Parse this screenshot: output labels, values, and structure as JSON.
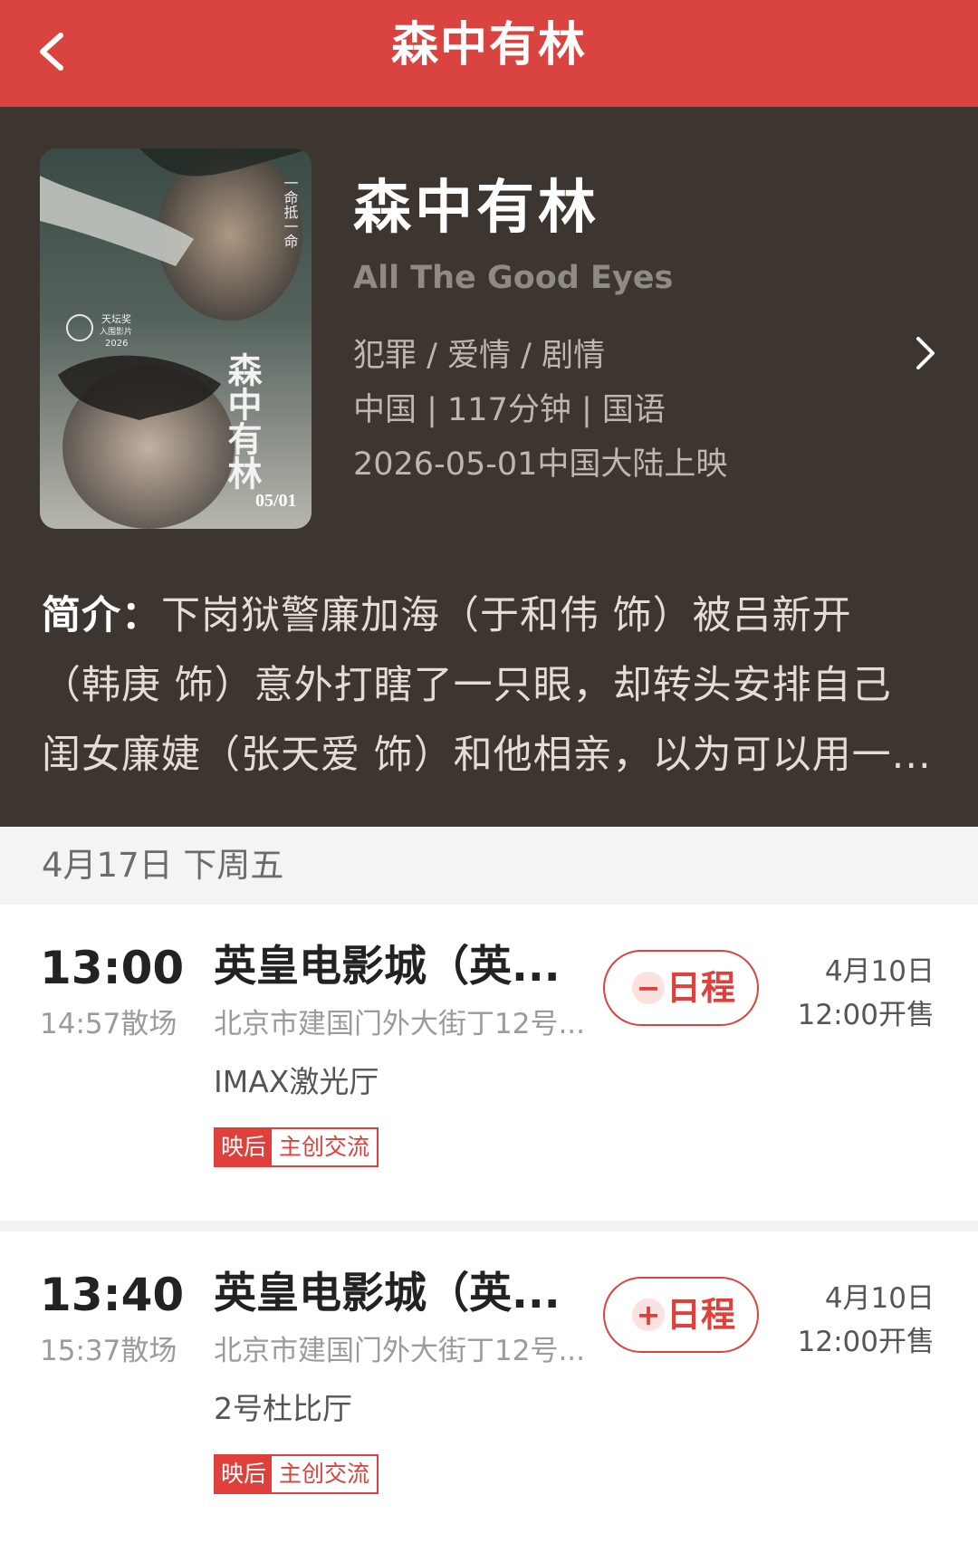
{
  "header": {
    "title": "森中有林",
    "back_icon": "chevron-left-icon"
  },
  "colors": {
    "header_bg": "#d94440",
    "info_bg": "#3d3630",
    "accent": "#e0403c"
  },
  "movie": {
    "title": "森中有林",
    "title_en": "All The Good Eyes",
    "genres": "犯罪 / 爱情 / 剧情",
    "country_duration_language": "中国 | 117分钟 | 国语",
    "release": "2026-05-01中国大陆上映",
    "synopsis_label": "简介：",
    "synopsis_lines": [
      "下岗狱警廉加海（于和伟 饰）被吕新开",
      "（韩庚 饰）意外打瞎了一只眼，却转头安排自己",
      "闺女廉婕（张天爱 饰）和他相亲，以为可以用一..."
    ],
    "detail_icon": "chevron-right-icon"
  },
  "poster": {
    "tagline": "一命抵一命",
    "title_calligraphy": "森中有林",
    "award_title": "天坛奖",
    "award_sub": "入围影片",
    "award_year": "2026",
    "date": "05/01"
  },
  "date_bar": {
    "label": "4月17日 下周五"
  },
  "showtimes": [
    {
      "start": "13:00",
      "end": "14:57散场",
      "cinema": "英皇电影城（英...",
      "address": "北京市建国门外大街丁12号...",
      "hall": "IMAX激光厅",
      "tag_a": "映后",
      "tag_b": "主创交流",
      "schedule_icon": "minus-icon",
      "schedule_symbol": "−",
      "schedule_label": "日程",
      "sale_date": "4月10日",
      "sale_time": "12:00开售"
    },
    {
      "start": "13:40",
      "end": "15:37散场",
      "cinema": "英皇电影城（英...",
      "address": "北京市建国门外大街丁12号...",
      "hall": "2号杜比厅",
      "tag_a": "映后",
      "tag_b": "主创交流",
      "schedule_icon": "plus-icon",
      "schedule_symbol": "+",
      "schedule_label": "日程",
      "sale_date": "4月10日",
      "sale_time": "12:00开售"
    }
  ]
}
